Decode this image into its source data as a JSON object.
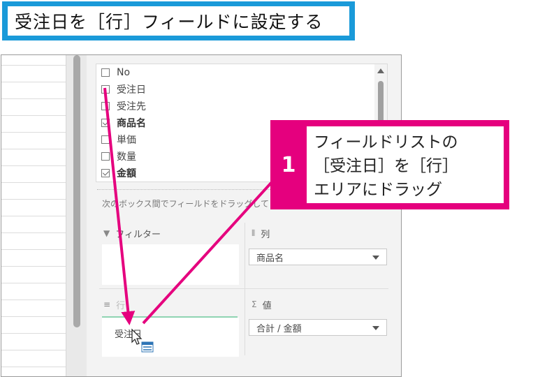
{
  "title": "受注日を［行］フィールドに設定する",
  "field_list": {
    "items": [
      {
        "label": "No",
        "checked": false,
        "bold": false
      },
      {
        "label": "受注日",
        "checked": false,
        "bold": false
      },
      {
        "label": "受注先",
        "checked": false,
        "bold": false
      },
      {
        "label": "商品名",
        "checked": true,
        "bold": true
      },
      {
        "label": "単価",
        "checked": false,
        "bold": false
      },
      {
        "label": "数量",
        "checked": false,
        "bold": false
      },
      {
        "label": "金額",
        "checked": true,
        "bold": true
      }
    ]
  },
  "instruction": "次のボックス間でフィールドをドラッグしてください:",
  "areas": {
    "filter_label": "フィルター",
    "columns_label": "列",
    "columns_value": "商品名",
    "rows_label": "行",
    "rows_value": "受注日",
    "values_label": "値",
    "values_value": "合計 / 金額"
  },
  "callout": {
    "number": "1",
    "line1": "フィールドリストの",
    "line2": "［受注日］を［行］",
    "line3": "エリアにドラッグ"
  },
  "colors": {
    "title_border": "#1a9ad9",
    "callout": "#e5007e",
    "arrow": "#e5007e"
  }
}
